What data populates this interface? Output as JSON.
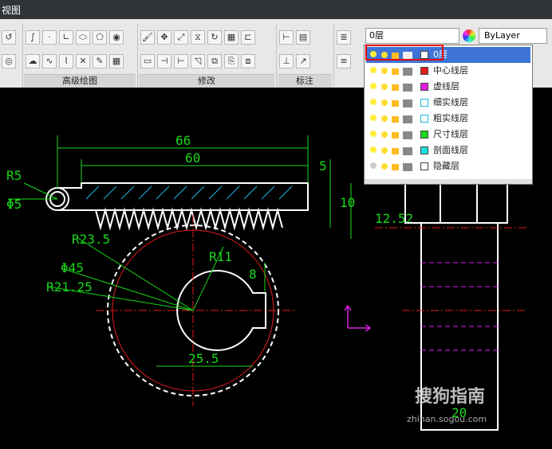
{
  "topbar": {
    "tab": "视图"
  },
  "ribbon": {
    "panels": [
      {
        "title": "高级绘图"
      },
      {
        "title": "修改"
      },
      {
        "title": "标注"
      }
    ],
    "layer_current": "0层",
    "color_current": "ByLayer"
  },
  "layer_dropdown": {
    "items": [
      {
        "name": "0层",
        "color": "#ffffff"
      },
      {
        "name": "中心线层",
        "color": "#e51c1c"
      },
      {
        "name": "虚线层",
        "color": "#e01ee0"
      },
      {
        "name": "细实线层",
        "color": "#ffffff"
      },
      {
        "name": "粗实线层",
        "color": "#ffffff"
      },
      {
        "name": "尺寸线层",
        "color": "#18d818"
      },
      {
        "name": "剖面线层",
        "color": "#19e0e0"
      },
      {
        "name": "隐藏层",
        "color": "#ffffff"
      }
    ]
  },
  "drawing": {
    "dims": {
      "d66": "66",
      "d60": "60",
      "d5v": "5",
      "d10": "10",
      "d12_52": "12.52",
      "r5": "R5",
      "phi5": "Φ5",
      "r23_5": "R23.5",
      "phi45": "Φ45",
      "r21_25": "R21.25",
      "r11": "R11",
      "d8": "8",
      "d25_5": "25.5",
      "d20": "20"
    }
  },
  "watermark": {
    "text": "搜狗指南",
    "url": "zhinan.sogou.com"
  },
  "colors": {
    "accent": "#3e74d6",
    "highlight": "#e60000",
    "dim": "#18d818"
  }
}
